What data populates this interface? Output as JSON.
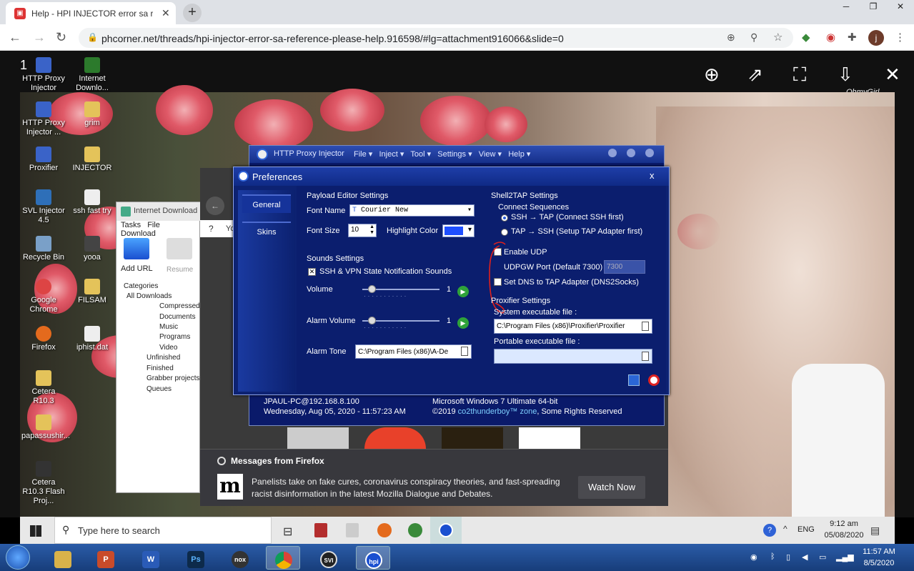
{
  "browser": {
    "tab_title": "Help - HPI INJECTOR error sa refe",
    "url": "phcorner.net/threads/hpi-injector-error-sa-reference-please-help.916598/#lg=attachment916066&slide=0",
    "profile_initial": "j"
  },
  "slide_counter": "1",
  "watermark": "OhmyGirl",
  "desktop_icons": [
    {
      "label": "HTTP Proxy Injector"
    },
    {
      "label": "Internet Downlo..."
    },
    {
      "label": "HTTP Proxy Injector ..."
    },
    {
      "label": "grim"
    },
    {
      "label": "Proxifier"
    },
    {
      "label": "INJECTOR"
    },
    {
      "label": "SVL Injector 4.5"
    },
    {
      "label": "ssh fast try"
    },
    {
      "label": "Recycle Bin"
    },
    {
      "label": "yooa"
    },
    {
      "label": "Google Chrome"
    },
    {
      "label": "FILSAM"
    },
    {
      "label": "Firefox"
    },
    {
      "label": "iphist.dat"
    },
    {
      "label": "Cetera R10.3"
    },
    {
      "label": "papassushir..."
    },
    {
      "label": "Cetera R10.3 Flash Proj..."
    }
  ],
  "idm": {
    "title": "Internet Download Ma",
    "menu": [
      "Tasks",
      "File",
      "Download"
    ],
    "add_url": "Add URL",
    "resume": "Resume",
    "categories": "Categories",
    "tree": [
      "All Downloads",
      "Compressed",
      "Documents",
      "Music",
      "Programs",
      "Video",
      "Unfinished",
      "Finished",
      "Grabber projects",
      "Queues"
    ]
  },
  "injector": {
    "title": "HTTP Proxy Injector",
    "menu": [
      "File",
      "Inject",
      "Tool",
      "Settings",
      "View",
      "Help"
    ],
    "status_host": "JPAUL-PC@192.168.8.100",
    "status_date": "Wednesday, Aug 05, 2020 - 11:57:23 AM",
    "status_os": "Microsoft Windows 7 Ultimate  64-bit",
    "status_copy_prefix": "©2019",
    "status_copy_brand": "co2thunderboy™ zone",
    "status_copy_suffix": ", Some Rights Reserved"
  },
  "preferences": {
    "title": "Preferences",
    "close": "x",
    "tabs": [
      "General",
      "Skins"
    ],
    "payload_heading": "Payload Editor Settings",
    "font_name_label": "Font Name",
    "font_name_value": "Courier New",
    "font_size_label": "Font Size",
    "font_size_value": "10",
    "highlight_label": "Highlight Color",
    "highlight_color": "#1f4fff",
    "sounds_heading": "Sounds Settings",
    "notif_sounds": "SSH & VPN State Notification Sounds",
    "notif_checked": true,
    "volume_label": "Volume",
    "volume_value": "1",
    "alarm_volume_label": "Alarm Volume",
    "alarm_volume_value": "1",
    "alarm_tone_label": "Alarm Tone",
    "alarm_tone_value": "C:\\Program Files (x86)\\A-De",
    "shell_heading": "Shell2TAP Settings",
    "connect_seq": "Connect Sequences",
    "radio_ssh_tap": "SSH → TAP (Connect SSH first)",
    "radio_tap_ssh": "TAP → SSH (Setup TAP Adapter first)",
    "enable_udp": "Enable UDP",
    "udpgw_label": "UDPGW Port (Default 7300)",
    "udpgw_value": "7300",
    "set_dns": "Set DNS to TAP Adapter (DNS2Socks)",
    "proxifier_heading": "Proxifier Settings",
    "system_exe_label": "System executable file :",
    "system_exe_value": "C:\\Program Files (x86)\\Proxifier\\Proxifier",
    "portable_exe_label": "Portable executable file :",
    "portable_exe_value": ""
  },
  "firefox_message": {
    "heading": "Messages from Firefox",
    "logo": "m",
    "body": "Panelists take on fake cures, coronavirus conspiracy theories, and fast-spreading racist disinformation in the latest Mozilla Dialogue and Debates.",
    "button": "Watch Now"
  },
  "partial_text": "Yo",
  "win10_taskbar": {
    "search_placeholder": "Type here to search",
    "lang": "ENG",
    "time": "9:12 am",
    "date": "05/08/2020"
  },
  "win7_taskbar": {
    "time": "11:57 AM",
    "date": "8/5/2020"
  }
}
